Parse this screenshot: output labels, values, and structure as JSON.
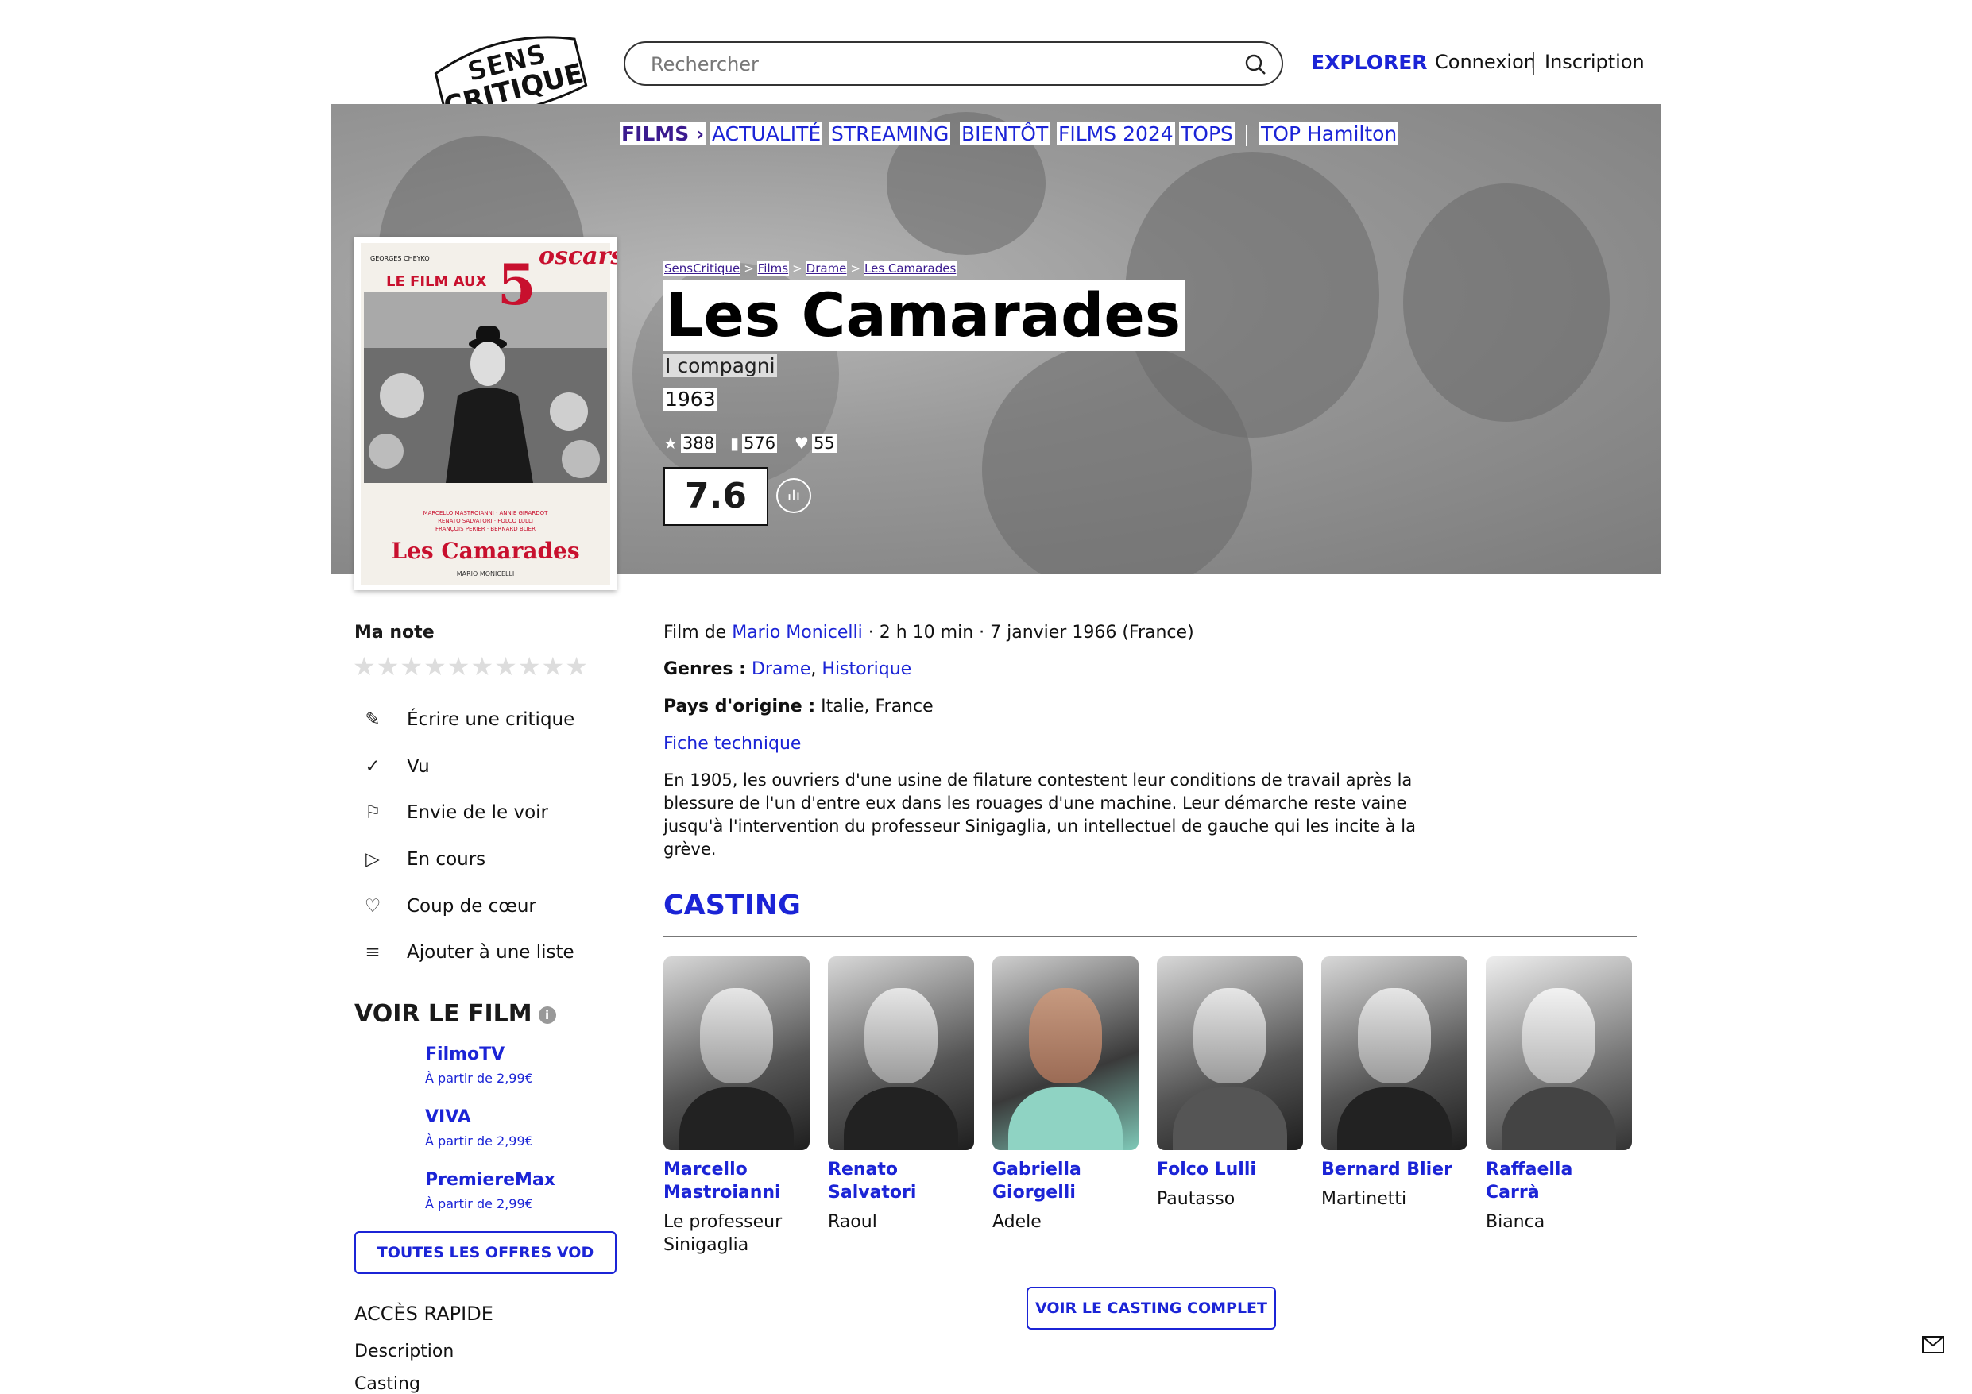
{
  "header": {
    "logo_line1": "SENS",
    "logo_line2": "CRITIQUE",
    "search_placeholder": "Rechercher",
    "explorer": "EXPLORER",
    "login": "Connexion",
    "signup": "Inscription"
  },
  "nav": {
    "items": [
      "FILMS",
      "ACTUALITÉ",
      "STREAMING",
      "BIENTÔT",
      "FILMS 2024",
      "TOPS",
      "TOP Hamilton"
    ]
  },
  "poster": {
    "top_text": "LE FILM AUX",
    "oscars_number": "5",
    "oscars_word": "oscars",
    "producer": "GEORGES CHEYKO",
    "credits": [
      "MARCELLO MASTROIANNI · ANNIE GIRARDOT",
      "RENATO SALVATORI · FOLCO LULLI",
      "FRANÇOIS PERIER · BERNARD BLIER"
    ],
    "title": "Les Camarades",
    "director": "MARIO MONICELLI"
  },
  "breadcrumb": [
    "SensCritique",
    "Films",
    "Drame",
    "Les Camarades"
  ],
  "movie": {
    "title": "Les Camarades",
    "original_title": "I compagni",
    "year": "1963",
    "stats": {
      "ratings": "388",
      "wishlist": "576",
      "favorites": "55"
    },
    "score": "7.6"
  },
  "details": {
    "film_de_label": "Film de",
    "director": "Mario Monicelli",
    "meta": "· 2 h 10 min · 7 janvier 1966 (France)",
    "genres_label": "Genres :",
    "genres": [
      "Drame",
      "Historique"
    ],
    "genres_sep": ",",
    "country_label": "Pays d'origine :",
    "countries": "Italie, France",
    "fiche": "Fiche technique",
    "synopsis": "En 1905, les ouvriers d'une usine de filature contestent leur conditions de travail après la blessure de l'un d'entre eux dans les rouages d'une machine. Leur démarche reste vaine jusqu'à l'intervention du professeur Sinigaglia, un intellectuel de gauche qui les incite à la grève."
  },
  "sidebar": {
    "ma_note": "Ma note",
    "stars": "★★★★★★★★★★",
    "actions": [
      {
        "icon": "pencil-icon",
        "label": "Écrire une critique"
      },
      {
        "icon": "check-icon",
        "label": "Vu"
      },
      {
        "icon": "bookmark-icon",
        "label": "Envie de le voir"
      },
      {
        "icon": "play-icon",
        "label": "En cours"
      },
      {
        "icon": "heart-icon",
        "label": "Coup de cœur"
      },
      {
        "icon": "list-add-icon",
        "label": "Ajouter à une liste"
      }
    ],
    "voir_le_film": "VOIR LE FILM",
    "vod": [
      {
        "name": "FilmoTV",
        "price": "À partir de 2,99€"
      },
      {
        "name": "VIVA",
        "price": "À partir de 2,99€"
      },
      {
        "name": "PremiereMax",
        "price": "À partir de 2,99€"
      }
    ],
    "all_vod": "TOUTES LES OFFRES VOD",
    "acces_rapide": "ACCÈS RAPIDE",
    "quick_links": [
      "Description",
      "Casting"
    ]
  },
  "casting": {
    "title": "CASTING",
    "cast": [
      {
        "name": "Marcello Mastroianni",
        "role": "Le professeur Sinigaglia"
      },
      {
        "name": "Renato Salvatori",
        "role": "Raoul"
      },
      {
        "name": "Gabriella Giorgelli",
        "role": "Adele"
      },
      {
        "name": "Folco Lulli",
        "role": "Pautasso"
      },
      {
        "name": "Bernard Blier",
        "role": "Martinetti"
      },
      {
        "name": "Raffaella Carrà",
        "role": "Bianca"
      }
    ],
    "full_button": "VOIR LE CASTING COMPLET"
  },
  "colors": {
    "accent": "#1b24d6",
    "films_nav": "#3b1b8f"
  }
}
